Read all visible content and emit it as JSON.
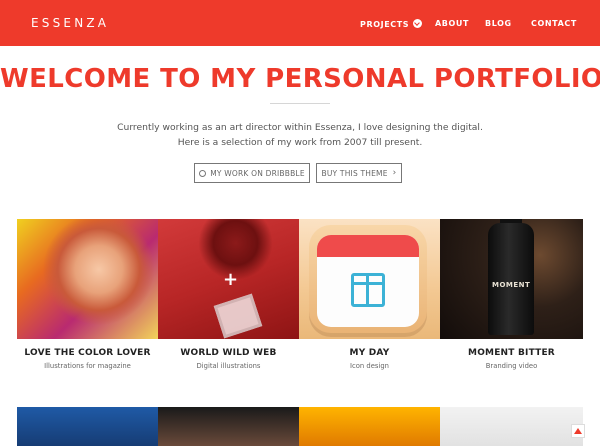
{
  "brand": {
    "name": "ESSENZA"
  },
  "nav": {
    "items": [
      {
        "label": "PROJECTS",
        "has_dropdown": true
      },
      {
        "label": "ABOUT"
      },
      {
        "label": "BLOG"
      },
      {
        "label": "CONTACT"
      }
    ]
  },
  "hero": {
    "title": "WELCOME TO MY PERSONAL PORTFOLIO",
    "description": "Currently working as an art director within Essenza, I love designing the digital. Here is a selection of my work from 2007 till present.",
    "buttons": [
      {
        "label": "MY WORK ON DRIBBBLE",
        "icon": "dribbble-icon"
      },
      {
        "label": "BUY THIS THEME",
        "icon": "chevron-right-icon"
      }
    ]
  },
  "portfolio": {
    "items": [
      {
        "title": "LOVE THE COLOR LOVER",
        "subtitle": "Illustrations for magazine"
      },
      {
        "title": "WORLD WILD WEB",
        "subtitle": "Digital illustrations"
      },
      {
        "title": "MY DAY",
        "subtitle": "Icon design"
      },
      {
        "title": "MOMENT BITTER",
        "subtitle": "Branding video"
      }
    ],
    "bottle_label": "MOMENT"
  },
  "colors": {
    "accent": "#ee3a2b",
    "text": "#222222",
    "muted": "#666666"
  }
}
